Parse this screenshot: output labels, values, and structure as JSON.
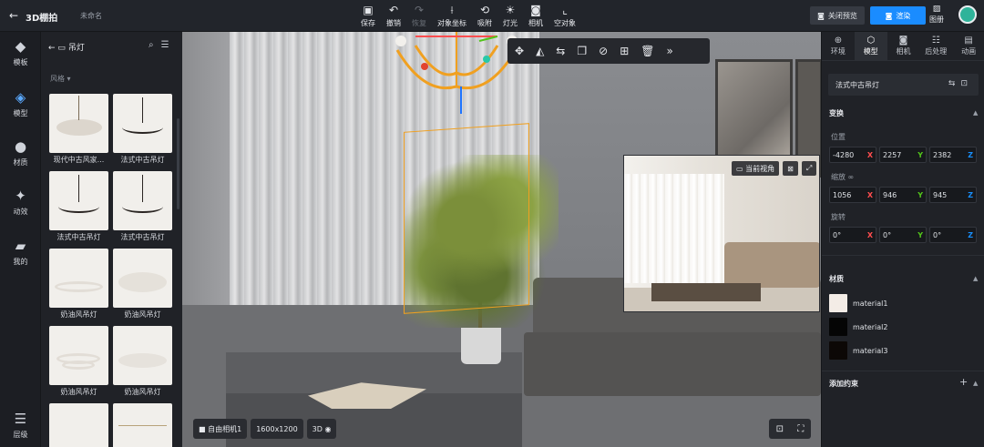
{
  "topbar": {
    "title": "3D棚拍",
    "doc_name": "未命名",
    "tools": [
      {
        "label": "保存",
        "icon": "save-icon",
        "enabled": true
      },
      {
        "label": "撤销",
        "icon": "undo-icon",
        "enabled": true
      },
      {
        "label": "恢复",
        "icon": "redo-icon",
        "enabled": false
      },
      {
        "label": "对象坐标",
        "icon": "axis-icon",
        "enabled": true
      },
      {
        "label": "吸附",
        "icon": "magnet-icon",
        "enabled": true
      },
      {
        "label": "灯光",
        "icon": "light-icon",
        "enabled": true
      },
      {
        "label": "相机",
        "icon": "camera-icon",
        "enabled": true
      },
      {
        "label": "空对象",
        "icon": "empty-object-icon",
        "enabled": true
      }
    ],
    "preview_label": "关闭预览",
    "render_label": "渲染",
    "gallery_label": "图册",
    "accent": "#1a8cff"
  },
  "leftnav": {
    "items": [
      {
        "label": "模板",
        "icon": "template-icon"
      },
      {
        "label": "模型",
        "icon": "model-icon",
        "active": true
      },
      {
        "label": "材质",
        "icon": "material-icon"
      },
      {
        "label": "动效",
        "icon": "motion-icon"
      },
      {
        "label": "我的",
        "icon": "my-folder-icon"
      },
      {
        "label": "层级",
        "icon": "layers-icon"
      }
    ]
  },
  "assets": {
    "category": "吊灯",
    "filter_label": "风格",
    "items": [
      {
        "label": "现代中古风家..."
      },
      {
        "label": "法式中古吊灯"
      },
      {
        "label": "法式中古吊灯"
      },
      {
        "label": "法式中古吊灯"
      },
      {
        "label": "奶油风吊灯"
      },
      {
        "label": "奶油风吊灯"
      },
      {
        "label": "奶油风吊灯"
      },
      {
        "label": "奶油风吊灯"
      },
      {
        "label": ""
      },
      {
        "label": ""
      }
    ]
  },
  "viewport": {
    "camera_label": "自由相机1",
    "resolution": "1600x1200",
    "mode": "3D",
    "preview_view_label": "当前视角"
  },
  "rightpanel": {
    "tabs": [
      {
        "label": "环境",
        "icon": "environment-icon"
      },
      {
        "label": "模型",
        "icon": "model-icon",
        "active": true
      },
      {
        "label": "相机",
        "icon": "camera-icon"
      },
      {
        "label": "后处理",
        "icon": "post-process-icon"
      },
      {
        "label": "动画",
        "icon": "animation-icon"
      }
    ],
    "object_name": "法式中古吊灯",
    "transform_title": "变换",
    "position_label": "位置",
    "position": {
      "x": "-4280",
      "y": "2257",
      "z": "2382"
    },
    "scale_label": "缩放",
    "scale": {
      "x": "1056",
      "y": "946",
      "z": "945"
    },
    "rotation_label": "旋转",
    "rotation": {
      "x": "0°",
      "y": "0°",
      "z": "0°"
    },
    "material_title": "材质",
    "materials": [
      {
        "name": "material1",
        "color": "#f3ece6"
      },
      {
        "name": "material2",
        "color": "#050505"
      },
      {
        "name": "material3",
        "color": "#0c0806"
      }
    ],
    "constraint_title": "添加约束"
  }
}
